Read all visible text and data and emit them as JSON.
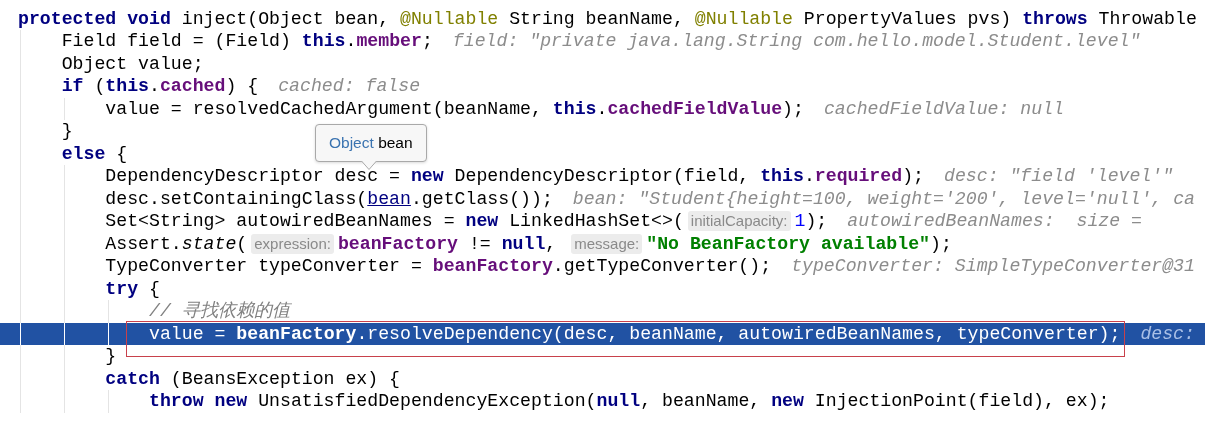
{
  "editor": {
    "lines": [
      {
        "current": false,
        "framed": false,
        "tokens": [
          {
            "kind": "keyword",
            "text": "protected void"
          },
          {
            "kind": "plain",
            "text": " inject(Object bean, "
          },
          {
            "kind": "annotation",
            "text": "@Nullable"
          },
          {
            "kind": "plain",
            "text": " String beanName, "
          },
          {
            "kind": "annotation",
            "text": "@Nullable"
          },
          {
            "kind": "plain",
            "text": " PropertyValues pvs) "
          },
          {
            "kind": "keyword",
            "text": "throws"
          },
          {
            "kind": "plain",
            "text": " Throwable"
          }
        ]
      },
      {
        "current": false,
        "framed": false,
        "tokens": [
          {
            "kind": "plain",
            "text": "    Field field = (Field) "
          },
          {
            "kind": "keyword",
            "text": "this"
          },
          {
            "kind": "plain",
            "text": "."
          },
          {
            "kind": "field",
            "text": "member"
          },
          {
            "kind": "plain",
            "text": ";"
          },
          {
            "kind": "value",
            "text": "field: \"private java.lang.String com.hello.model.Student.level\""
          }
        ]
      },
      {
        "current": false,
        "framed": false,
        "tokens": [
          {
            "kind": "plain",
            "text": "    Object value;"
          }
        ]
      },
      {
        "current": false,
        "framed": false,
        "tokens": [
          {
            "kind": "keyword",
            "text": "    if"
          },
          {
            "kind": "plain",
            "text": " ("
          },
          {
            "kind": "keyword",
            "text": "this"
          },
          {
            "kind": "plain",
            "text": "."
          },
          {
            "kind": "field",
            "text": "cached"
          },
          {
            "kind": "plain",
            "text": ") {"
          },
          {
            "kind": "value",
            "text": "cached: false"
          }
        ]
      },
      {
        "current": false,
        "framed": false,
        "tokens": [
          {
            "kind": "plain",
            "text": "        value = resolvedCachedArgument(beanName, "
          },
          {
            "kind": "keyword",
            "text": "this"
          },
          {
            "kind": "plain",
            "text": "."
          },
          {
            "kind": "field",
            "text": "cachedFieldValue"
          },
          {
            "kind": "plain",
            "text": ");"
          },
          {
            "kind": "value",
            "text": "cachedFieldValue: null"
          }
        ]
      },
      {
        "current": false,
        "framed": false,
        "tokens": [
          {
            "kind": "plain",
            "text": "    }"
          }
        ]
      },
      {
        "current": false,
        "framed": false,
        "tokens": [
          {
            "kind": "keyword",
            "text": "    else"
          },
          {
            "kind": "plain",
            "text": " {"
          }
        ]
      },
      {
        "current": false,
        "framed": false,
        "tokens": [
          {
            "kind": "plain",
            "text": "        DependencyDescriptor desc = "
          },
          {
            "kind": "keyword",
            "text": "new"
          },
          {
            "kind": "plain",
            "text": " DependencyDescriptor(field, "
          },
          {
            "kind": "keyword",
            "text": "this"
          },
          {
            "kind": "plain",
            "text": "."
          },
          {
            "kind": "field",
            "text": "required"
          },
          {
            "kind": "plain",
            "text": ");"
          },
          {
            "kind": "value",
            "text": "desc: \"field 'level'\""
          }
        ]
      },
      {
        "current": false,
        "framed": false,
        "tokens": [
          {
            "kind": "plain",
            "text": "        desc.setContainingClass("
          },
          {
            "kind": "link",
            "text": "bean"
          },
          {
            "kind": "plain",
            "text": ".getClass());"
          },
          {
            "kind": "value",
            "text": "bean: \"Student{height=100, weight='200', level='null', ca"
          }
        ]
      },
      {
        "current": false,
        "framed": false,
        "tokens": [
          {
            "kind": "plain",
            "text": "        Set<String> autowiredBeanNames = "
          },
          {
            "kind": "keyword",
            "text": "new"
          },
          {
            "kind": "plain",
            "text": " LinkedHashSet<>("
          },
          {
            "kind": "param",
            "text": "initialCapacity:"
          },
          {
            "kind": "number",
            "text": "1"
          },
          {
            "kind": "plain",
            "text": ");"
          },
          {
            "kind": "value",
            "text": "autowiredBeanNames:  size ="
          }
        ]
      },
      {
        "current": false,
        "framed": false,
        "tokens": [
          {
            "kind": "plain",
            "text": "        Assert."
          },
          {
            "kind": "static",
            "text": "state"
          },
          {
            "kind": "plain",
            "text": "("
          },
          {
            "kind": "param",
            "text": "expression:"
          },
          {
            "kind": "field",
            "text": "beanFactory"
          },
          {
            "kind": "plain",
            "text": " != "
          },
          {
            "kind": "keyword",
            "text": "null"
          },
          {
            "kind": "plain",
            "text": ", "
          },
          {
            "kind": "param",
            "text": "message:"
          },
          {
            "kind": "string",
            "text": "\"No BeanFactory available\""
          },
          {
            "kind": "plain",
            "text": ");"
          }
        ]
      },
      {
        "current": false,
        "framed": false,
        "tokens": [
          {
            "kind": "plain",
            "text": "        TypeConverter typeConverter = "
          },
          {
            "kind": "field",
            "text": "beanFactory"
          },
          {
            "kind": "plain",
            "text": ".getTypeConverter();"
          },
          {
            "kind": "value",
            "text": "typeConverter: SimpleTypeConverter@31"
          }
        ]
      },
      {
        "current": false,
        "framed": false,
        "tokens": [
          {
            "kind": "keyword",
            "text": "        try"
          },
          {
            "kind": "plain",
            "text": " {"
          }
        ]
      },
      {
        "current": false,
        "framed": false,
        "tokens": [
          {
            "kind": "comment",
            "text": "            // 寻找依赖的值"
          }
        ]
      },
      {
        "current": true,
        "framed": true,
        "tokens": [
          {
            "kind": "plain",
            "text": "            value = "
          },
          {
            "kind": "field",
            "text": "beanFactory"
          },
          {
            "kind": "plain",
            "text": ".resolveDependency(desc, beanName, autowiredBeanNames, typeConverter);"
          },
          {
            "kind": "value",
            "text": "desc:"
          }
        ]
      },
      {
        "current": false,
        "framed": false,
        "tokens": [
          {
            "kind": "plain",
            "text": "        }"
          }
        ]
      },
      {
        "current": false,
        "framed": false,
        "tokens": [
          {
            "kind": "keyword",
            "text": "        catch"
          },
          {
            "kind": "plain",
            "text": " (BeansException ex) {"
          }
        ]
      },
      {
        "current": false,
        "framed": false,
        "tokens": [
          {
            "kind": "keyword",
            "text": "            throw new"
          },
          {
            "kind": "plain",
            "text": " UnsatisfiedDependencyException("
          },
          {
            "kind": "keyword",
            "text": "null"
          },
          {
            "kind": "plain",
            "text": ", beanName, "
          },
          {
            "kind": "keyword",
            "text": "new"
          },
          {
            "kind": "plain",
            "text": " InjectionPoint(field), ex);"
          }
        ]
      }
    ]
  },
  "tooltip": {
    "type": "Object",
    "name": "bean"
  }
}
